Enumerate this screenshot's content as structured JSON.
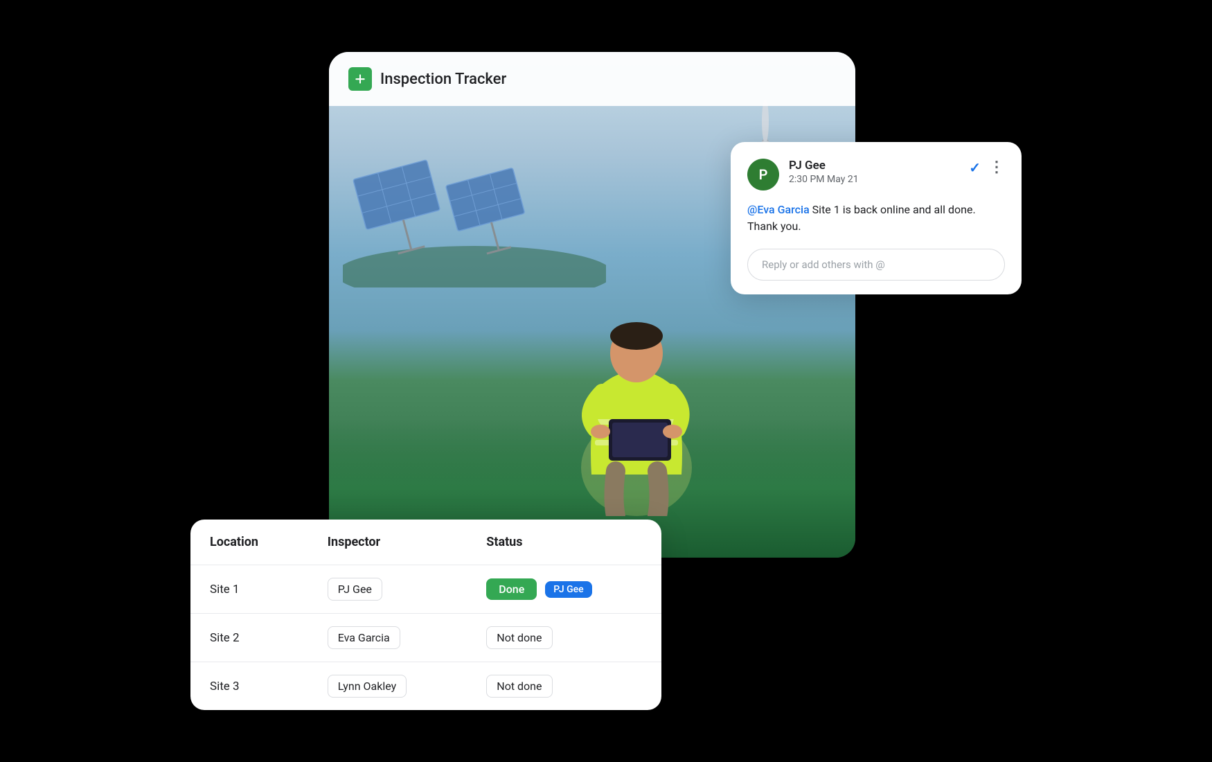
{
  "app": {
    "title": "Inspection Tracker"
  },
  "chat": {
    "sender_name": "PJ Gee",
    "sender_initial": "P",
    "timestamp": "2:30 PM May 21",
    "mention": "@Eva Garcia",
    "message_text": " Site 1 is back online and all done. Thank you.",
    "reply_placeholder": "Reply or add others with @"
  },
  "table": {
    "headers": [
      "Location",
      "Inspector",
      "Status"
    ],
    "rows": [
      {
        "location": "Site 1",
        "inspector": "PJ Gee",
        "status": "Done",
        "status_type": "done",
        "badge": "PJ Gee"
      },
      {
        "location": "Site 2",
        "inspector": "Eva Garcia",
        "status": "Not done",
        "status_type": "not-done",
        "badge": null
      },
      {
        "location": "Site 3",
        "inspector": "Lynn Oakley",
        "status": "Not done",
        "status_type": "not-done",
        "badge": null
      }
    ]
  },
  "icons": {
    "sheets": "✚",
    "check": "✓",
    "more": "⋮"
  }
}
